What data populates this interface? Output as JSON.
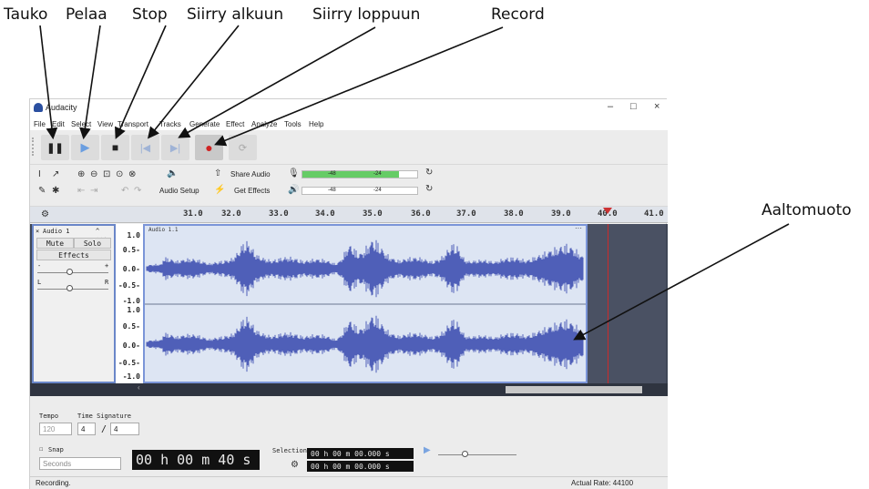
{
  "callouts": {
    "pause": "Tauko",
    "play": "Pelaa",
    "stop": "Stop",
    "skip_start": "Siirry alkuun",
    "skip_end": "Siirry loppuun",
    "record": "Record",
    "waveform": "Aaltomuoto"
  },
  "window": {
    "title": "Audacity",
    "min": "–",
    "max": "□",
    "close": "×"
  },
  "menu": [
    "File",
    "Edit",
    "Select",
    "View",
    "Transport",
    "Tracks",
    "Generate",
    "Effect",
    "Analyze",
    "Tools",
    "Help"
  ],
  "tools": {
    "audio_setup": "Audio Setup",
    "share_audio": "Share Audio",
    "get_effects": "Get Effects",
    "meter_ticks": [
      "-48",
      "-24"
    ]
  },
  "ruler": {
    "ticks": [
      "31.0",
      "32.0",
      "33.0",
      "34.0",
      "35.0",
      "36.0",
      "37.0",
      "38.0",
      "39.0",
      "40.0",
      "41.0"
    ]
  },
  "track": {
    "name": "Audio 1",
    "mute": "Mute",
    "solo": "Solo",
    "effects": "Effects",
    "gain_minus": "-",
    "gain_plus": "+",
    "pan_left": "L",
    "pan_right": "R",
    "clip_name": "Audio 1.1",
    "clip_menu": "···",
    "scale": [
      "1.0",
      "0.5-",
      "0.0-",
      "-0.5-",
      "-1.0"
    ]
  },
  "bottom": {
    "tempo_label": "Tempo",
    "tempo_value": "120",
    "time_sig_label": "Time Signature",
    "time_sig_num": "4",
    "time_sig_sep": "/",
    "time_sig_den": "4",
    "snap_label": "Snap",
    "snap_unit": "Seconds",
    "time_display": "00 h 00 m 40 s",
    "selection_label": "Selection",
    "sel_start": "00 h 00 m 00.000 s",
    "sel_end": "00 h 00 m 00.000 s"
  },
  "status": {
    "left": "Recording.",
    "right": "Actual Rate: 44100"
  }
}
